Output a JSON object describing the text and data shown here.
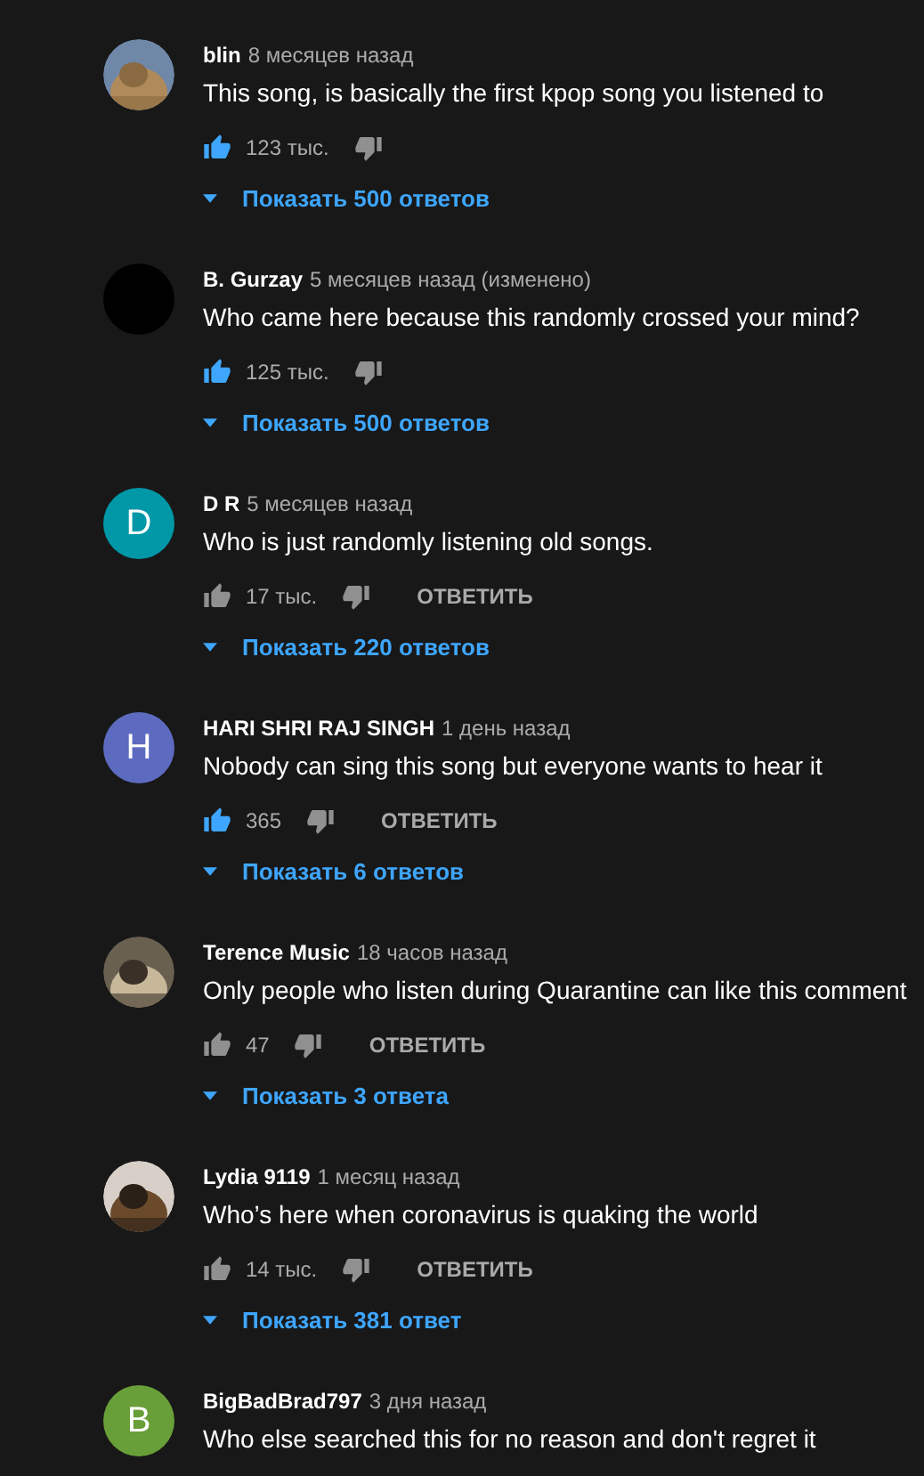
{
  "comments": [
    {
      "author": "blin",
      "time": "8 месяцев назад",
      "text": "This song, is basically the first kpop song you listened to",
      "likes": "123 тыс.",
      "liked": true,
      "replies": "Показать 500 ответов"
    },
    {
      "avatar": {
        "kind": "plain",
        "color": "#000000"
      },
      "author": "B. Gurzay",
      "time": "5 месяцев назад (изменено)",
      "text": "Who came here because this randomly crossed your mind?",
      "likes": "125 тыс.",
      "liked": true,
      "replies": "Показать 500 ответов"
    },
    {
      "avatar": {
        "kind": "letter",
        "letter": "D",
        "color": "#0097a7"
      },
      "author": "D R",
      "time": "5 месяцев назад",
      "text": "Who is just randomly listening old songs.",
      "likes": "17 тыс.",
      "liked": false,
      "reply": "ОТВЕТИТЬ",
      "replies": "Показать 220 ответов"
    },
    {
      "avatar": {
        "kind": "letter",
        "letter": "H",
        "color": "#5c6bc0"
      },
      "author": "HARI SHRI RAJ SINGH",
      "time": "1 день назад",
      "text": "Nobody can sing this song but everyone wants to hear it",
      "likes": "365",
      "liked": true,
      "reply": "ОТВЕТИТЬ",
      "replies": "Показать 6 ответов"
    },
    {
      "author": "Terence Music",
      "time": "18 часов назад",
      "text": "Only people who listen during Quarantine can like this comment",
      "likes": "47",
      "liked": false,
      "reply": "ОТВЕТИТЬ",
      "replies": "Показать 3 ответа"
    },
    {
      "author": "Lydia 9119",
      "time": "1 месяц назад",
      "text": "Who’s here when coronavirus is quaking the world",
      "likes": "14 тыс.",
      "liked": false,
      "reply": "ОТВЕТИТЬ",
      "replies": "Показать 381 ответ"
    },
    {
      "avatar": {
        "kind": "letter",
        "letter": "B",
        "color": "#689f38"
      },
      "author": "BigBadBrad797",
      "time": "3 дня назад",
      "text": "Who else searched this for no reason and don't regret it"
    }
  ]
}
